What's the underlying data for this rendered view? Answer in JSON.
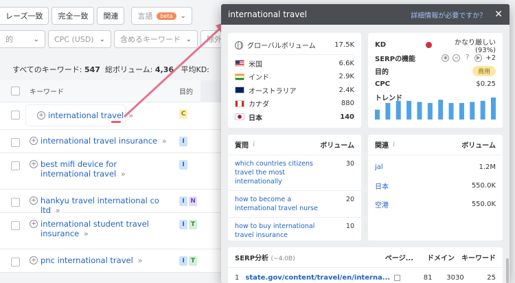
{
  "filters": {
    "match_phrase": "レーズ一致",
    "match_exact": "完全一致",
    "match_related": "関連",
    "language": "言語",
    "beta": "beta",
    "intent_partial": "的",
    "cpc": "CPC (USD)",
    "include_keywords": "含めるキーワード",
    "exclude_partial": "除外"
  },
  "stats": {
    "all_keywords_label": "すべてのキーワード:",
    "all_keywords_value": "547",
    "total_volume_label": "総ボリューム:",
    "total_volume_value": "4,36",
    "avg_kd_label": "平均KD:"
  },
  "table": {
    "col_keyword": "キーワード",
    "col_intent": "目的",
    "rows": [
      {
        "keyword": "international travel",
        "intents": [
          "C"
        ]
      },
      {
        "keyword": "international travel insurance",
        "intents": [
          "I"
        ]
      },
      {
        "keyword": "best mifi device for international travel",
        "intents": [
          "I"
        ]
      },
      {
        "keyword": "hankyu travel international co ltd",
        "intents": [
          "I",
          "N"
        ]
      },
      {
        "keyword": "international student travel insurance",
        "intents": [
          "I",
          "T"
        ]
      },
      {
        "keyword": "pnc international travel",
        "intents": [
          "I",
          "T"
        ]
      }
    ]
  },
  "popup": {
    "title": "international travel",
    "more_info_link": "詳細情報が必要ですか？",
    "close": "✕",
    "volume": {
      "global_label": "グローバルボリューム",
      "global_value": "17.5K",
      "countries": [
        {
          "name": "米国",
          "value": "6.6K",
          "flag": "us"
        },
        {
          "name": "インド",
          "value": "2.9K",
          "flag": "in"
        },
        {
          "name": "オーストラリア",
          "value": "2.4K",
          "flag": "au"
        },
        {
          "name": "カナダ",
          "value": "880",
          "flag": "ca"
        },
        {
          "name": "日本",
          "value": "140",
          "flag": "jp"
        }
      ]
    },
    "metrics": {
      "kd_label": "KD",
      "kd_value": "かなり厳しい (93%)",
      "kd_color": "#d0323c",
      "serp_label": "SERPの機能",
      "serp_icons": [
        "location-icon",
        "link-icon",
        "question-icon",
        "video-icon"
      ],
      "serp_more": "+2",
      "intent_label": "目的",
      "intent_value": "商用",
      "cpc_label": "CPC",
      "cpc_value": "$0.25",
      "trend_label": "トレンド",
      "trend_values": [
        0.45,
        0.75,
        0.85,
        0.85,
        0.8,
        0.75,
        0.9,
        0.75,
        0.75,
        0.8,
        0.85,
        1.0
      ]
    },
    "questions": {
      "header": "質問",
      "volume_header": "ボリューム",
      "rows": [
        {
          "text": "which countries citizens travel the most internationally",
          "value": "30"
        },
        {
          "text": "how to become a international travel nurse",
          "value": "20"
        },
        {
          "text": "how to buy international travel insurance",
          "value": "10"
        }
      ]
    },
    "related": {
      "header": "関連",
      "volume_header": "ボリューム",
      "rows": [
        {
          "text": "jal",
          "value": "1.2M"
        },
        {
          "text": "日本",
          "value": "550.0K"
        },
        {
          "text": "空港",
          "value": "550.0K"
        }
      ]
    },
    "serp": {
      "header": "SERP分析",
      "header_count": "(~4.0B)",
      "cols": [
        "ページ...",
        "ドメイン",
        "キーワード"
      ],
      "rows": [
        {
          "rank": "1",
          "url": "state.gov/content/travel/en/interna...",
          "page": "81",
          "domain": "3030",
          "keywords": "25"
        }
      ]
    }
  }
}
